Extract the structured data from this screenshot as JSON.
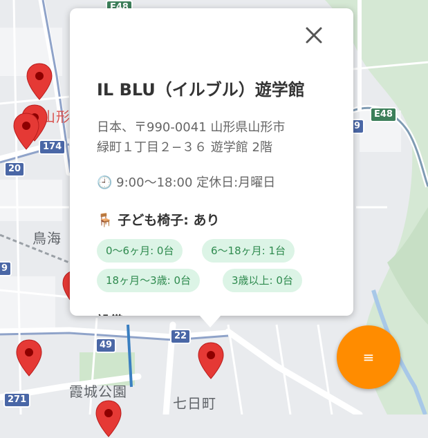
{
  "map": {
    "labels": {
      "yamagata_partial": "山形",
      "chokai": "鳥海",
      "kajo_park": "霞城公園",
      "nanokamachi": "七日町"
    },
    "road_badges": {
      "e48_top": "E48",
      "e48_right": "E48",
      "r174": "174",
      "r20": "20",
      "r49": "49",
      "r22": "22",
      "r271": "271",
      "r9_right": "9",
      "r9_left": "9"
    },
    "colors": {
      "pin": "#e53935",
      "fab": "#ff8c00",
      "chip_bg": "#dcf4e6",
      "chip_text": "#2e8a4e"
    }
  },
  "popup": {
    "title": "IL BLU（イルブル）遊学館",
    "address_line1": "日本、〒990-0041 山形県山形市",
    "address_line2": "緑町１丁目２−３６ 遊学館 2階",
    "hours_icon": "🕘",
    "hours": "9:00〜18:00 定休日:月曜日",
    "chair_icon": "🪑",
    "chair_label": "子ども椅子: あり",
    "chips": [
      "0〜6ヶ月: 0台",
      "6〜18ヶ月: 1台",
      "18ヶ月〜3歳: 0台",
      "3歳以上: 0台"
    ],
    "next_section_cut": "設備",
    "close_icon": "close-icon"
  },
  "fab": {
    "label": "≡"
  }
}
